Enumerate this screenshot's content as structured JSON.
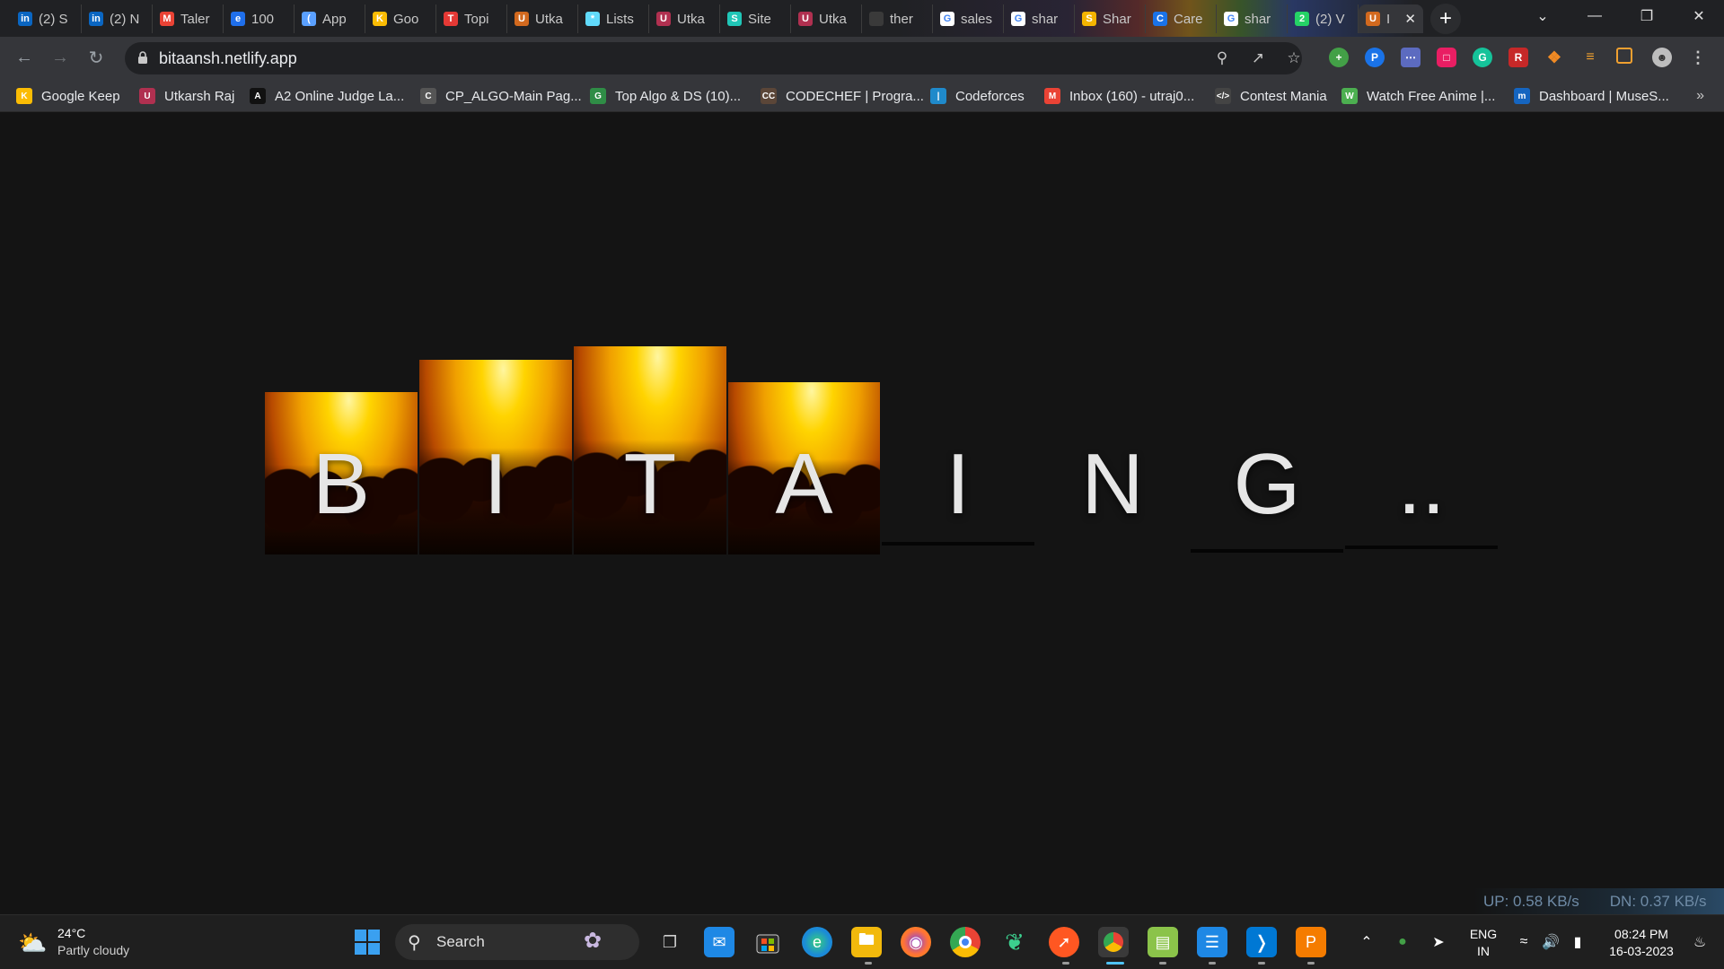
{
  "browser": {
    "tabs": [
      {
        "label": "(2) S",
        "icon": "linkedin-icon",
        "color": "#0a66c2",
        "glyph": "in"
      },
      {
        "label": "(2) N",
        "icon": "linkedin-icon",
        "color": "#0a66c2",
        "glyph": "in"
      },
      {
        "label": "Taler",
        "icon": "gmail-icon",
        "color": "#ea4335",
        "glyph": "M"
      },
      {
        "label": "100",
        "icon": "edge-icon",
        "color": "#1f6feb",
        "glyph": "e"
      },
      {
        "label": "App",
        "icon": "moon-icon",
        "color": "#5aa0ff",
        "glyph": "("
      },
      {
        "label": "Goo",
        "icon": "keep-icon",
        "color": "#fbbc04",
        "glyph": "K"
      },
      {
        "label": "Topi",
        "icon": "topic-icon",
        "color": "#e53935",
        "glyph": "T"
      },
      {
        "label": "Utka",
        "icon": "globe-icon",
        "color": "#d2691e",
        "glyph": "U"
      },
      {
        "label": "Lists",
        "icon": "react-icon",
        "color": "#61dafb",
        "glyph": "*"
      },
      {
        "label": "Utka",
        "icon": "hex-icon",
        "color": "#b03050",
        "glyph": "U"
      },
      {
        "label": "Site",
        "icon": "netlify-icon",
        "color": "#20c6b7",
        "glyph": "S"
      },
      {
        "label": "Utka",
        "icon": "hex-icon",
        "color": "#b03050",
        "glyph": "U"
      },
      {
        "label": "ther",
        "icon": "blank-icon",
        "color": "#3a3a3a",
        "glyph": ""
      },
      {
        "label": "sales",
        "icon": "google-icon",
        "color": "#ffffff",
        "glyph": "G"
      },
      {
        "label": "shar",
        "icon": "google-icon",
        "color": "#ffffff",
        "glyph": "G"
      },
      {
        "label": "Shar",
        "icon": "chrome-colors-icon",
        "color": "#f4b400",
        "glyph": "S"
      },
      {
        "label": "Care",
        "icon": "shield-icon",
        "color": "#1a73e8",
        "glyph": "C"
      },
      {
        "label": "shar",
        "icon": "google-icon",
        "color": "#ffffff",
        "glyph": "G"
      },
      {
        "label": "(2) V",
        "icon": "whatsapp-icon",
        "color": "#25d366",
        "glyph": "2"
      },
      {
        "label": "I",
        "icon": "globe-icon",
        "color": "#d2691e",
        "glyph": "U",
        "active": true
      }
    ],
    "url": "bitaansh.netlify.app",
    "bookmarks": [
      {
        "label": "Google Keep",
        "icon": "keep-icon",
        "color": "#fbbc04",
        "glyph": "K"
      },
      {
        "label": "Utkarsh Raj",
        "icon": "hex-icon",
        "color": "#b03050",
        "glyph": "U"
      },
      {
        "label": "A2 Online Judge La...",
        "icon": "a2-icon",
        "color": "#111111",
        "glyph": "A"
      },
      {
        "label": "CP_ALGO-Main Pag...",
        "icon": "cp-algo-icon",
        "color": "#555555",
        "glyph": "C"
      },
      {
        "label": "Top Algo & DS (10)...",
        "icon": "gfg-icon",
        "color": "#2f8d46",
        "glyph": "G"
      },
      {
        "label": "CODECHEF | Progra...",
        "icon": "codechef-icon",
        "color": "#5b4638",
        "glyph": "CC"
      },
      {
        "label": "Codeforces",
        "icon": "codeforces-icon",
        "color": "#1f8acb",
        "glyph": "|"
      },
      {
        "label": "Inbox (160) - utraj0...",
        "icon": "gmail-icon",
        "color": "#ea4335",
        "glyph": "M"
      },
      {
        "label": "Contest Mania",
        "icon": "code-icon",
        "color": "#444444",
        "glyph": "</>"
      },
      {
        "label": "Watch Free Anime |...",
        "icon": "anime-icon",
        "color": "#4caf50",
        "glyph": "W"
      },
      {
        "label": "Dashboard | MuseS...",
        "icon": "muse-icon",
        "color": "#1565c0",
        "glyph": "m"
      }
    ]
  },
  "page": {
    "tiles": [
      {
        "letter": "B"
      },
      {
        "letter": "I"
      },
      {
        "letter": "T"
      },
      {
        "letter": "A"
      },
      {
        "letter": "I"
      },
      {
        "letter": "N"
      },
      {
        "letter": "G"
      },
      {
        "letter": ".."
      }
    ],
    "netspeed": {
      "up": "UP: 0.58 KB/s",
      "down": "DN: 0.37 KB/s"
    }
  },
  "taskbar": {
    "weather": {
      "temp": "24°C",
      "condition": "Partly cloudy"
    },
    "search_label": "Search",
    "lang": "ENG",
    "region": "IN",
    "time": "08:24 PM",
    "date": "16-03-2023"
  }
}
